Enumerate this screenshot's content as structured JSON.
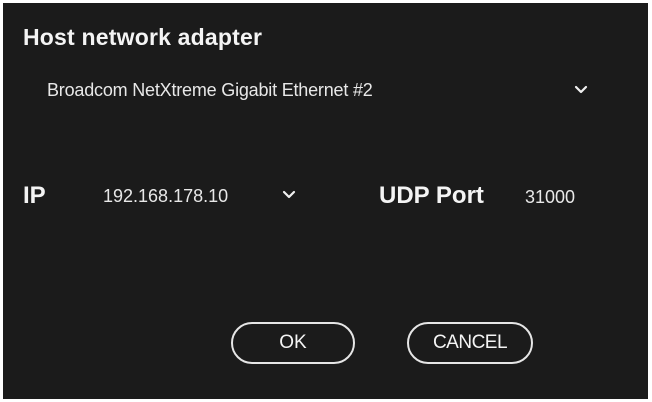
{
  "dialog": {
    "title": "Host network adapter",
    "adapter": {
      "selected": "Broadcom NetXtreme Gigabit Ethernet #2",
      "icon": "chevron-down-icon"
    },
    "ip": {
      "label": "IP",
      "selected": "192.168.178.10",
      "icon": "chevron-down-icon"
    },
    "udp": {
      "label": "UDP Port",
      "value": "31000"
    },
    "buttons": {
      "ok_label": "OK",
      "cancel_label": "CANCEL"
    },
    "colors": {
      "background": "#1b1b1b",
      "text": "#f4f4f4",
      "button_border": "#e6e6e6"
    }
  }
}
